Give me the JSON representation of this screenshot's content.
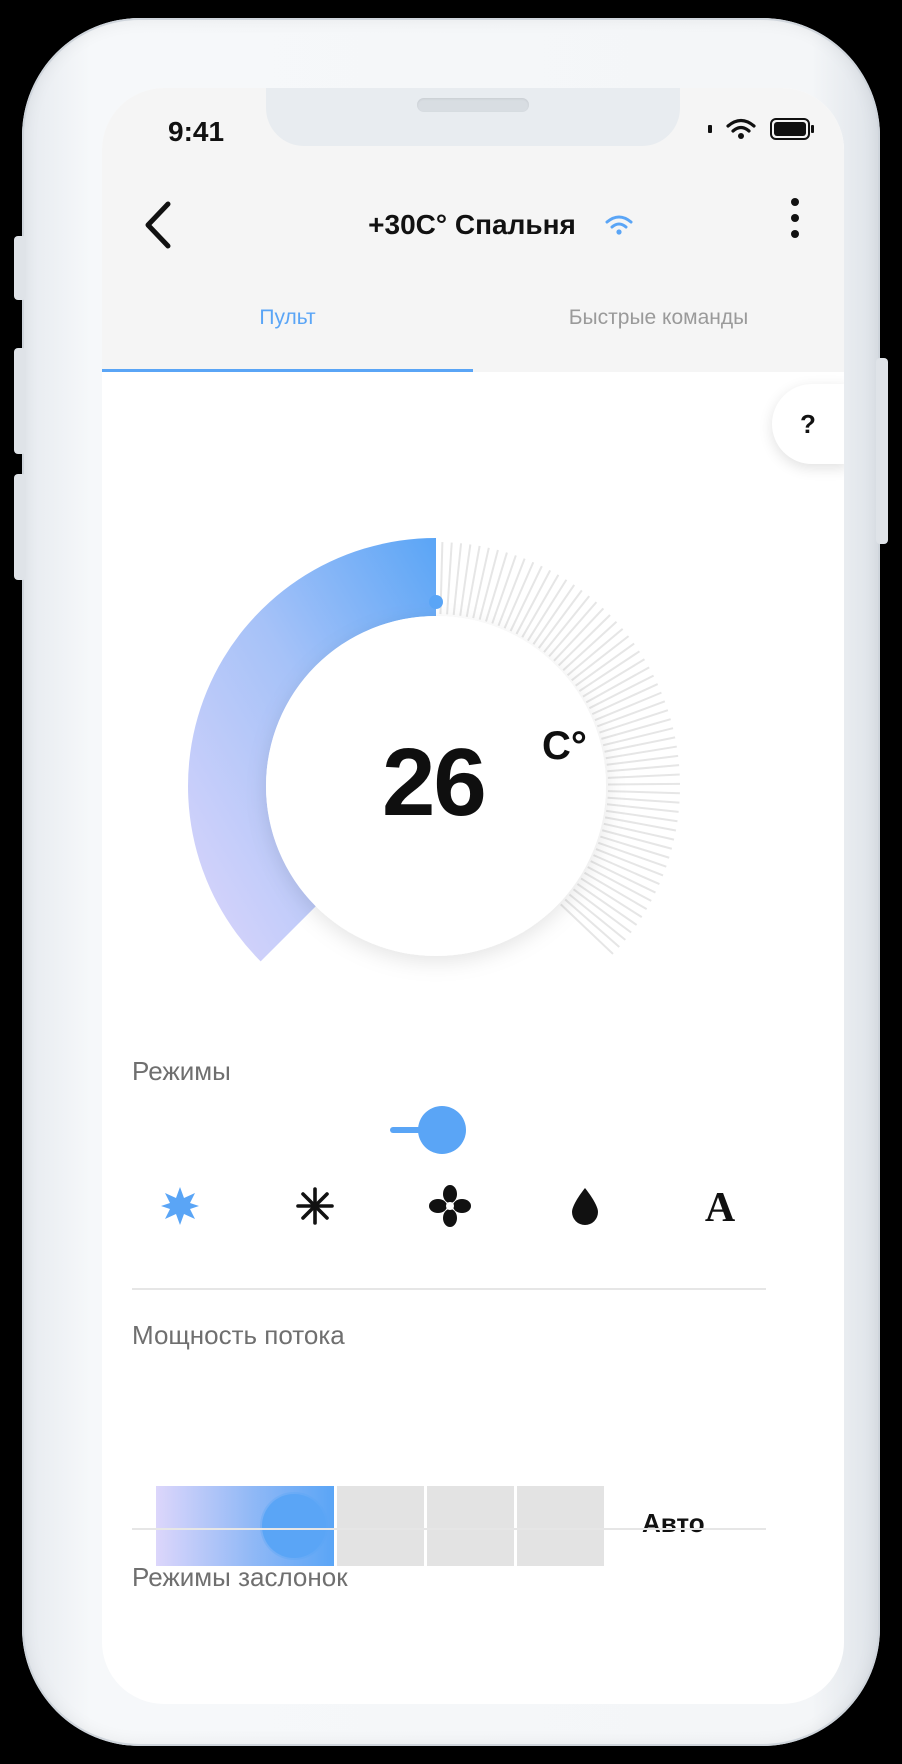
{
  "status_bar": {
    "time": "9:41",
    "icons": [
      "signal-icon",
      "wifi-icon",
      "battery-icon"
    ]
  },
  "header": {
    "back_icon": "chevron-left-icon",
    "title": "+30C° Спальня",
    "connection_icon": "wifi-icon",
    "menu_icon": "kebab-menu-icon"
  },
  "tabs": [
    {
      "label": "Пульт",
      "active": true
    },
    {
      "label": "Быстрые команды",
      "active": false
    }
  ],
  "help": {
    "label": "?"
  },
  "thermostat": {
    "temperature": "26",
    "unit": "C°",
    "set_fraction": 0.5,
    "colors": {
      "gradient_start": "#ddd6fb",
      "gradient_end": "#5aa5f6",
      "inactive_ticks": "#e6e6e6"
    }
  },
  "power_toggle": {
    "on": true,
    "color": "#5aa5f6"
  },
  "modes": {
    "label": "Режимы",
    "items": [
      {
        "icon": "sun-icon",
        "selected": true
      },
      {
        "icon": "snowflake-icon",
        "selected": false
      },
      {
        "icon": "fan-icon",
        "selected": false
      },
      {
        "icon": "drop-icon",
        "selected": false
      },
      {
        "icon": "auto-a-icon",
        "selected": false
      }
    ]
  },
  "flow_power": {
    "label": "Мощность потока",
    "level": 1,
    "levels": 4,
    "auto_label": "Авто"
  },
  "flaps": {
    "label": "Режимы заслонок"
  },
  "accent_color": "#5aa5f6"
}
